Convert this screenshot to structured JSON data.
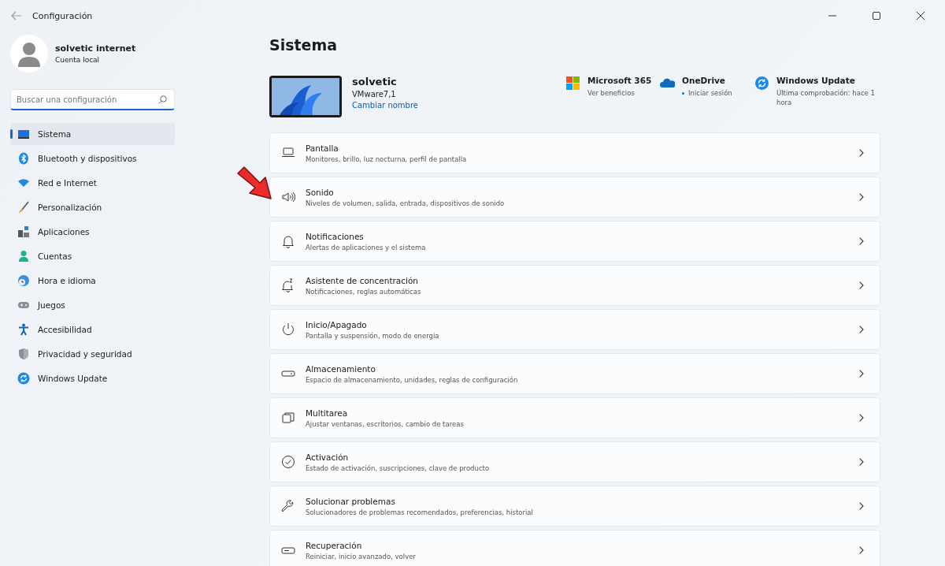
{
  "window": {
    "title": "Configuración"
  },
  "profile": {
    "name": "solvetic internet",
    "account": "Cuenta local"
  },
  "search": {
    "placeholder": "Buscar una configuración"
  },
  "sidebar": {
    "items": [
      {
        "label": "Sistema",
        "selected": true
      },
      {
        "label": "Bluetooth y dispositivos",
        "selected": false
      },
      {
        "label": "Red e Internet",
        "selected": false
      },
      {
        "label": "Personalización",
        "selected": false
      },
      {
        "label": "Aplicaciones",
        "selected": false
      },
      {
        "label": "Cuentas",
        "selected": false
      },
      {
        "label": "Hora e idioma",
        "selected": false
      },
      {
        "label": "Juegos",
        "selected": false
      },
      {
        "label": "Accesibilidad",
        "selected": false
      },
      {
        "label": "Privacidad y seguridad",
        "selected": false
      },
      {
        "label": "Windows Update",
        "selected": false
      }
    ]
  },
  "page": {
    "title": "Sistema"
  },
  "device": {
    "name": "solvetic",
    "model": "VMware7,1",
    "rename_link": "Cambiar nombre"
  },
  "quick_links": [
    {
      "title": "Microsoft 365",
      "subtitle": "Ver beneficios"
    },
    {
      "title": "OneDrive",
      "subtitle": "Iniciar sesión"
    },
    {
      "title": "Windows Update",
      "subtitle": "Última comprobación: hace 1 hora"
    }
  ],
  "settings": [
    {
      "title": "Pantalla",
      "subtitle": "Monitores, brillo, luz nocturna, perfil de pantalla"
    },
    {
      "title": "Sonido",
      "subtitle": "Niveles de volumen, salida, entrada, dispositivos de sonido"
    },
    {
      "title": "Notificaciones",
      "subtitle": "Alertas de aplicaciones y el sistema"
    },
    {
      "title": "Asistente de concentración",
      "subtitle": "Notificaciones, reglas automáticas"
    },
    {
      "title": "Inicio/Apagado",
      "subtitle": "Pantalla y suspensión, modo de energía"
    },
    {
      "title": "Almacenamiento",
      "subtitle": "Espacio de almacenamiento, unidades, reglas de configuración"
    },
    {
      "title": "Multitarea",
      "subtitle": "Ajustar ventanas, escritorios, cambio de tareas"
    },
    {
      "title": "Activación",
      "subtitle": "Estado de activación, suscripciones, clave de producto"
    },
    {
      "title": "Solucionar problemas",
      "subtitle": "Solucionadores de problemas recomendados, preferencias, historial"
    },
    {
      "title": "Recuperación",
      "subtitle": "Reiniciar, inicio avanzado, volver"
    }
  ]
}
